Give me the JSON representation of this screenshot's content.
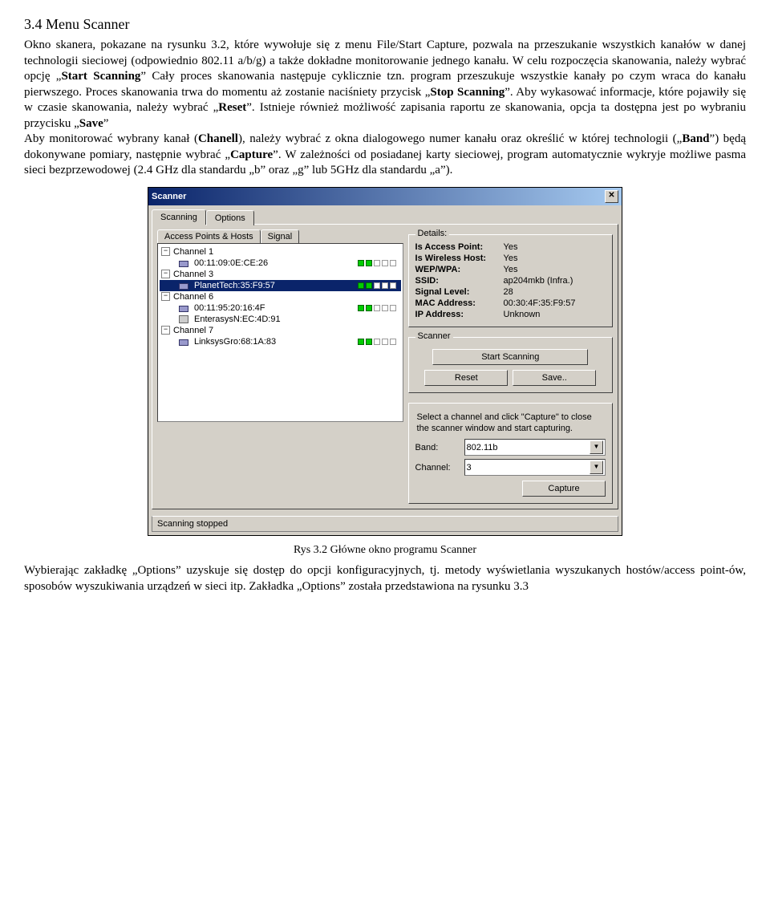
{
  "doc": {
    "heading": "3.4 Menu Scanner",
    "para1_pre": "Okno skanera, pokazane na rysunku 3.2, które wywołuje się z menu File/Start Capture, pozwala na przeszukanie wszystkich kanałów w danej technologii sieciowej (odpowiednio 802.11 a/b/g) a także dokładne monitorowanie jednego kanału. W celu rozpoczęcia skanowania, należy wybrać opcję „",
    "para1_b1": "Start Scanning",
    "para1_mid1": "” Cały proces skanowania następuje cyklicznie tzn. program przeszukuje wszystkie kanały po czym wraca do kanału pierwszego. Proces skanowania trwa do momentu aż zostanie naciśniety przycisk „",
    "para1_b2": "Stop Scanning",
    "para1_mid2": "”. Aby wykasować informacje, które pojawiły się w czasie skanowania, należy wybrać „",
    "para1_b3": "Reset",
    "para1_mid3": "”. Istnieje również możliwość zapisania raportu ze skanowania, opcja ta dostępna jest po wybraniu przycisku „",
    "para1_b4": "Save",
    "para1_end": "”",
    "para2_a": "Aby monitorować wybrany kanał (",
    "para2_b1": "Chanell",
    "para2_b": "), należy wybrać z okna dialogowego numer kanału oraz określić w której technologii („",
    "para2_b2": "Band",
    "para2_c": "”) będą dokonywane pomiary, następnie wybrać „",
    "para2_b3": "Capture",
    "para2_d": "”. W zależności od posiadanej karty sieciowej, program automatycznie wykryje możliwe pasma sieci bezprzewodowej (2.4 GHz dla standardu „b” oraz „g”  lub 5GHz dla standardu „a”).",
    "caption": "Rys 3.2 Główne okno programu Scanner",
    "para3": "Wybierając zakładkę „Options” uzyskuje się dostęp do opcji konfiguracyjnych, tj. metody wyświetlania wyszukanych hostów/access point-ów, sposobów wyszukiwania urządzeń w sieci itp. Zakładka „Options” została przedstawiona na rysunku 3.3"
  },
  "win": {
    "title": "Scanner",
    "tabs": {
      "scanning": "Scanning",
      "options": "Options"
    },
    "subtabs": {
      "aph": "Access Points & Hosts",
      "signal": "Signal"
    },
    "tree": {
      "ch1": "Channel 1",
      "ch1_item": "00:11:09:0E:CE:26",
      "ch3": "Channel 3",
      "ch3_item": "PlanetTech:35:F9:57",
      "ch6": "Channel 6",
      "ch6_item1": "00:11:95:20:16:4F",
      "ch6_item2": "EnterasysN:EC:4D:91",
      "ch7": "Channel 7",
      "ch7_item": "LinksysGro:68:1A:83"
    },
    "details": {
      "title": "Details:",
      "rows": [
        {
          "k": "Is Access Point:",
          "v": "Yes"
        },
        {
          "k": "Is Wireless Host:",
          "v": "Yes"
        },
        {
          "k": "WEP/WPA:",
          "v": "Yes"
        },
        {
          "k": "SSID:",
          "v": "ap204mkb (Infra.)"
        },
        {
          "k": "Signal Level:",
          "v": "28"
        },
        {
          "k": "MAC Address:",
          "v": "00:30:4F:35:F9:57"
        },
        {
          "k": "IP Address:",
          "v": "Unknown"
        }
      ]
    },
    "scanner_group": "Scanner",
    "btn_start": "Start Scanning",
    "btn_reset": "Reset",
    "btn_save": "Save..",
    "helptext": "Select a channel and click \"Capture\" to close the scanner window and start capturing.",
    "band_label": "Band:",
    "band_value": "802.11b",
    "channel_label": "Channel:",
    "channel_value": "3",
    "btn_capture": "Capture",
    "status": "Scanning stopped"
  }
}
